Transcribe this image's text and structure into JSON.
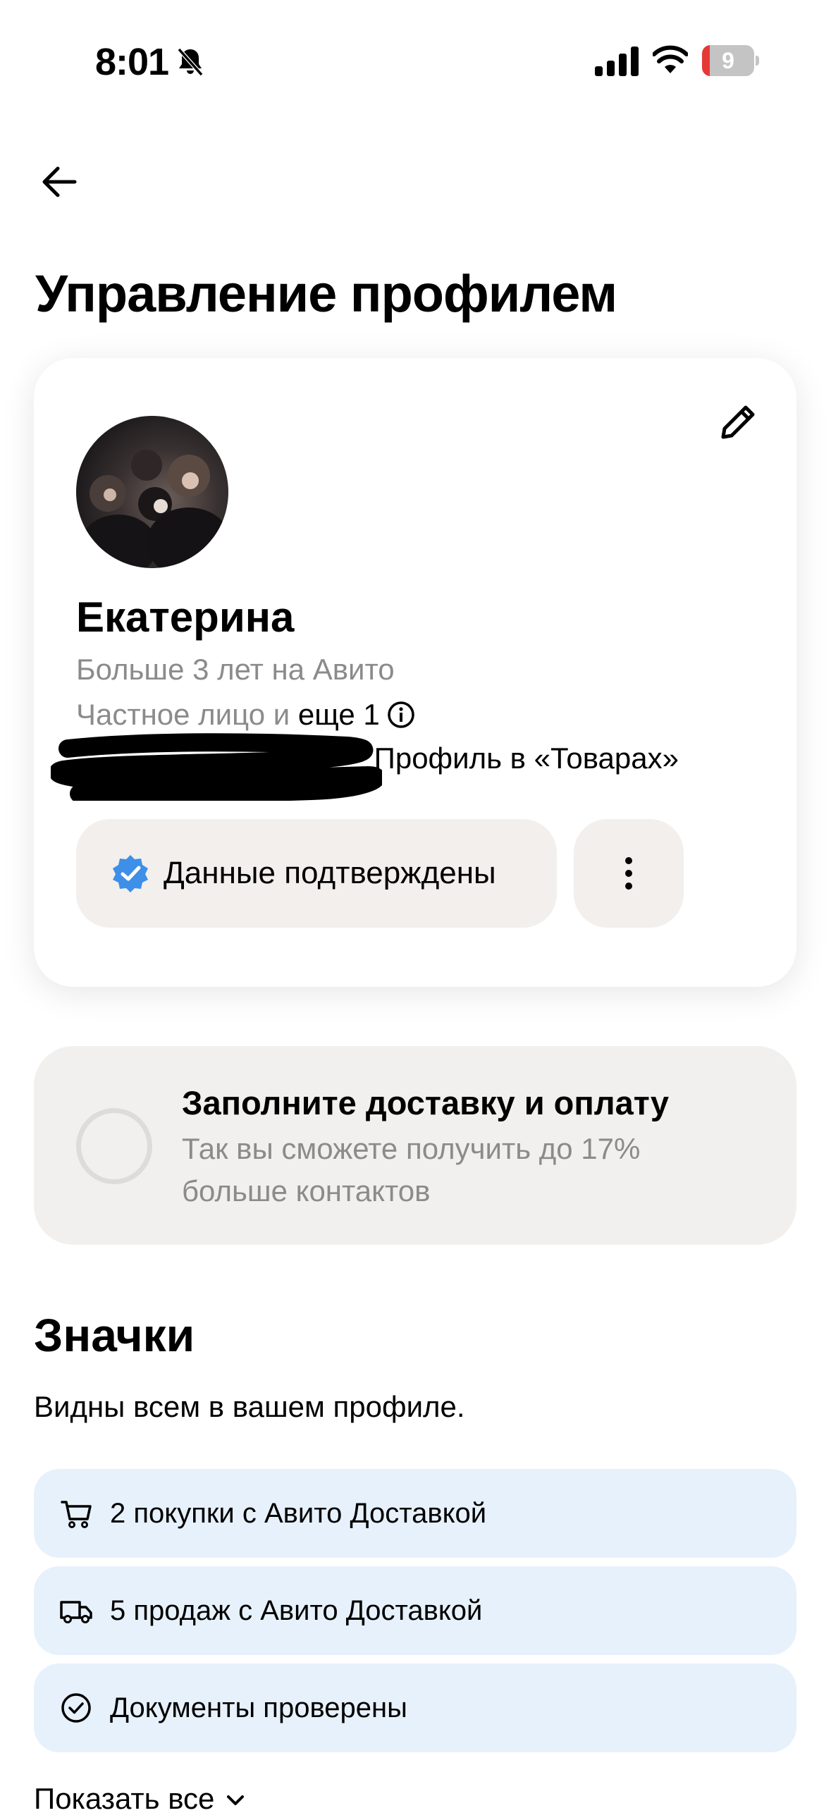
{
  "status_bar": {
    "time": "8:01",
    "battery": "9"
  },
  "page": {
    "title": "Управление профилем"
  },
  "profile": {
    "name": "Екатерина",
    "tenure": "Больше 3 лет на Авито",
    "type_prefix": "Частное лицо и",
    "type_more": "еще 1",
    "market_profile": "· Профиль в «Товарах»",
    "verified_label": "Данные подтверждены"
  },
  "delivery_promo": {
    "title": "Заполните доставку и оплату",
    "text": "Так вы сможете получить до 17% больше контактов"
  },
  "badges_section": {
    "title": "Значки",
    "subtitle": "Видны всем в вашем профиле.",
    "items": [
      {
        "label": "2 покупки с Авито Доставкой",
        "icon": "cart-icon"
      },
      {
        "label": "5 продаж с Авито Доставкой",
        "icon": "truck-icon"
      },
      {
        "label": "Документы проверены",
        "icon": "check-circle-icon"
      }
    ],
    "show_all": "Показать все"
  },
  "colors": {
    "verified_blue": "#3d8fe8",
    "badge_bg": "#e7f1fb",
    "chip_bg": "#f2efec",
    "battery_low": "#e53935"
  }
}
